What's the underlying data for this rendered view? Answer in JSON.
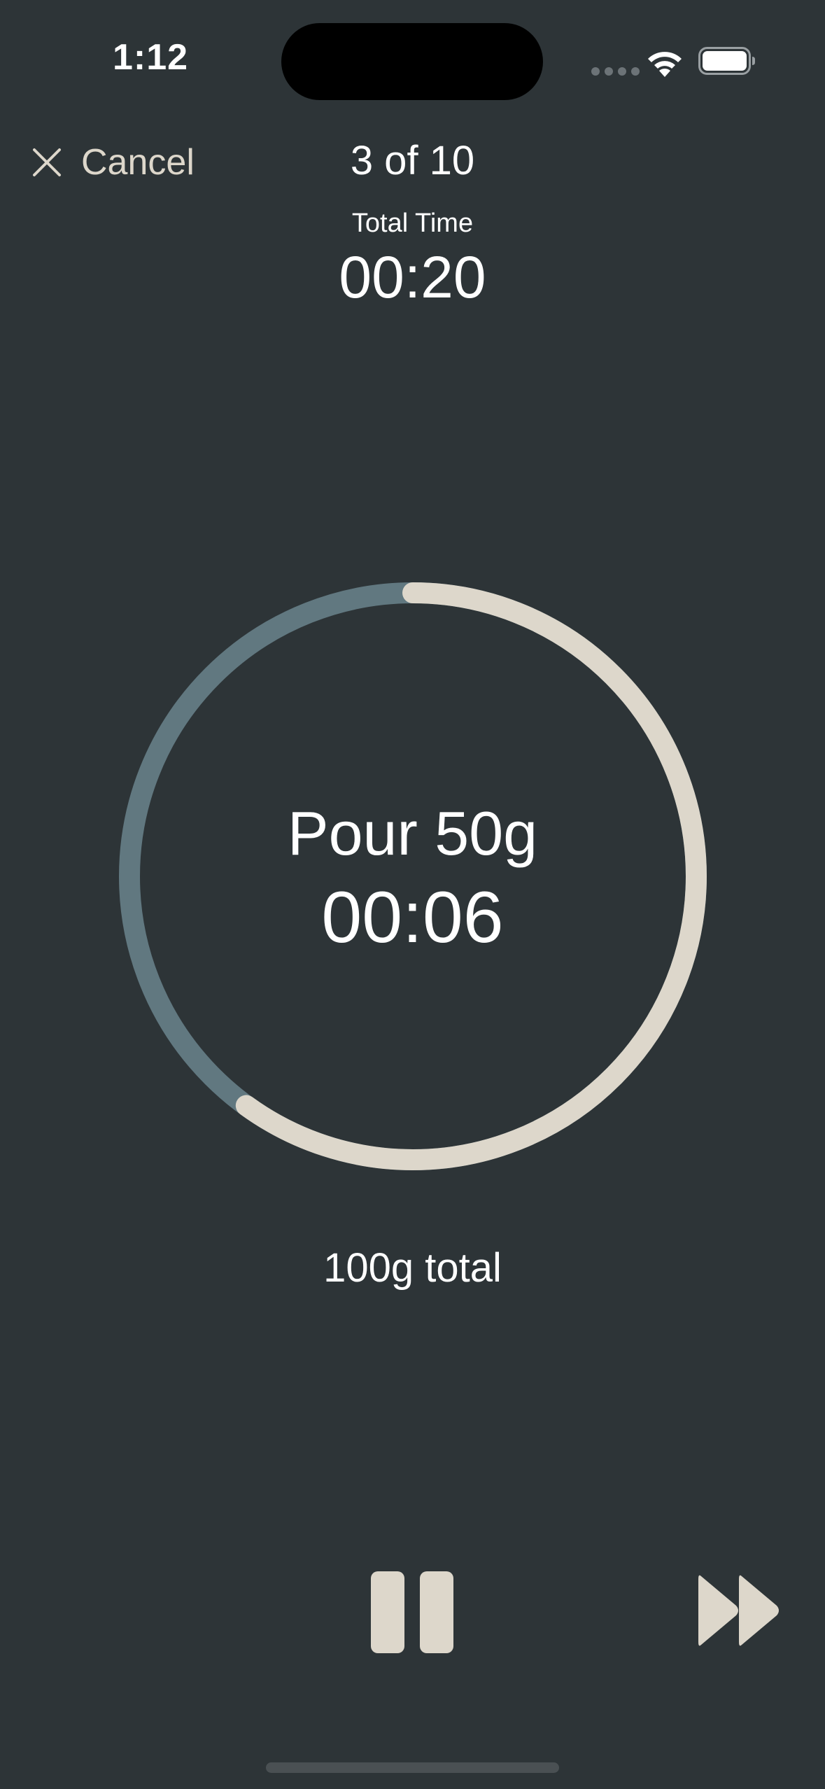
{
  "status_bar": {
    "time": "1:12"
  },
  "header": {
    "cancel_label": "Cancel",
    "step_counter": "3 of 10",
    "total_time_label": "Total Time",
    "total_time_value": "00:20"
  },
  "step": {
    "instruction": "Pour 50g",
    "timer": "00:06",
    "progress_fraction": 0.6,
    "total_weight": "100g total"
  },
  "controls": {
    "pause_icon": "pause-icon",
    "skip_icon": "fast-forward-icon"
  },
  "colors": {
    "background": "#2d3437",
    "accent": "#ddd7cb",
    "ring_track": "#617880",
    "text": "#ffffff"
  }
}
